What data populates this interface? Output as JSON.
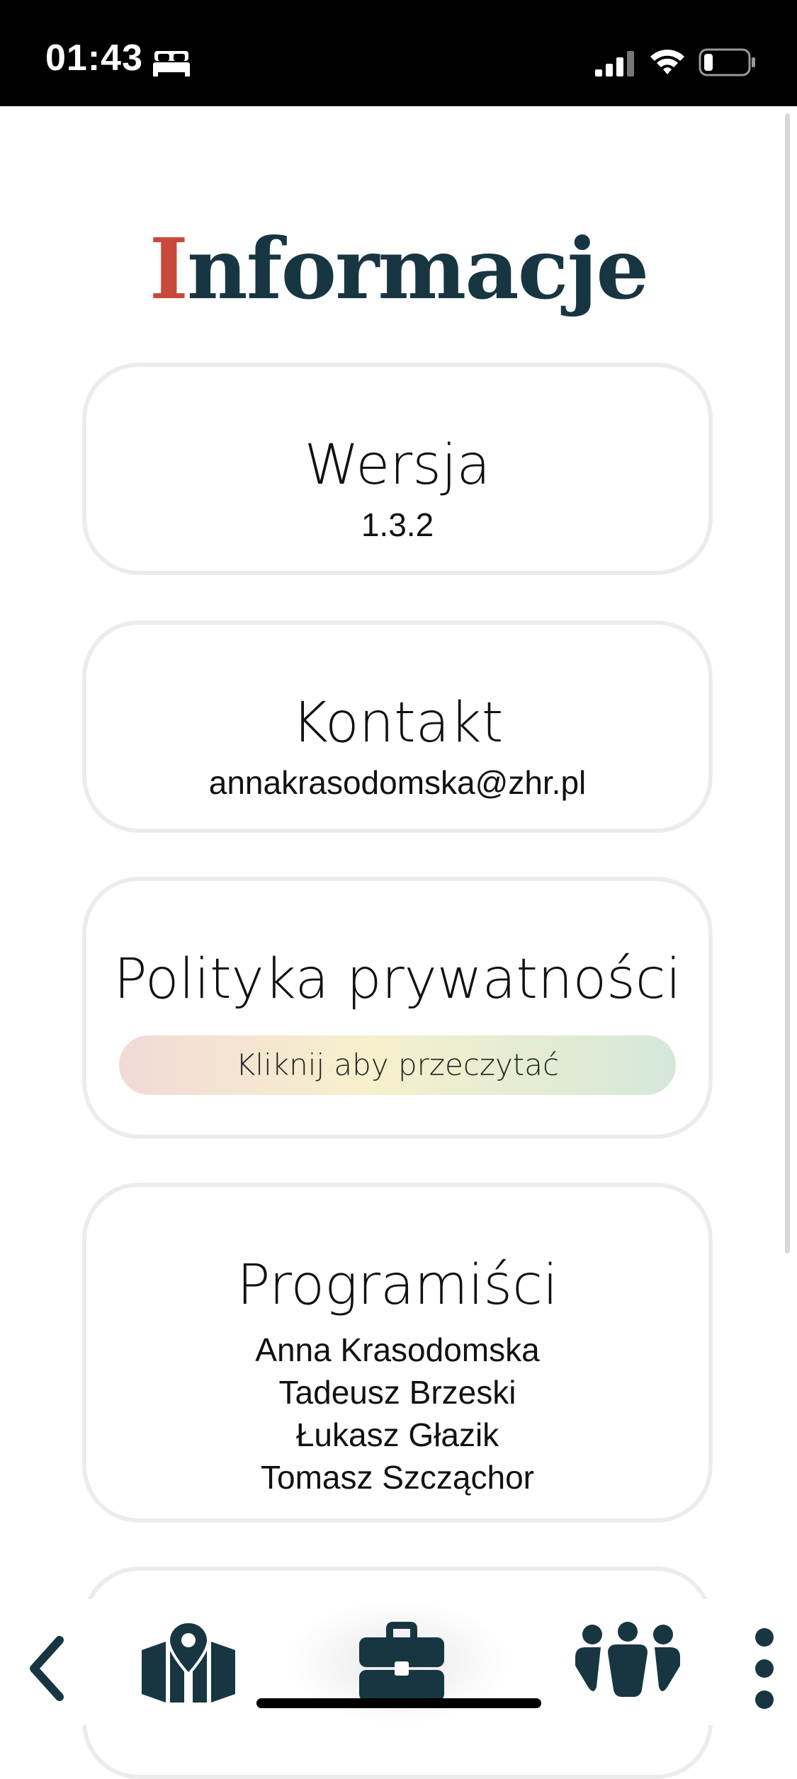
{
  "status_bar": {
    "time": "01:43",
    "icons": [
      "bed-icon",
      "signal-icon",
      "wifi-icon",
      "battery-icon"
    ]
  },
  "page": {
    "title_first_letter": "I",
    "title_rest": "nformacje"
  },
  "cards": {
    "version": {
      "title": "Wersja",
      "value": "1.3.2"
    },
    "contact": {
      "title": "Kontakt",
      "value": "annakrasodomska@zhr.pl"
    },
    "privacy": {
      "title": "Polityka prywatności",
      "button_label": "Kliknij aby przeczytać"
    },
    "developers": {
      "title": "Programiści",
      "names": [
        "Anna Krasodomska",
        "Tadeusz Brzeski",
        "Łukasz Głazik",
        "Tomasz Szcząchor"
      ]
    }
  },
  "bottom_nav": {
    "items": [
      "back-icon",
      "map-icon",
      "briefcase-icon",
      "people-icon",
      "more-icon"
    ],
    "active": "briefcase-icon"
  },
  "colors": {
    "brand_dark": "#173642",
    "brand_red": "#c84a3a",
    "card_border": "#ececec"
  }
}
